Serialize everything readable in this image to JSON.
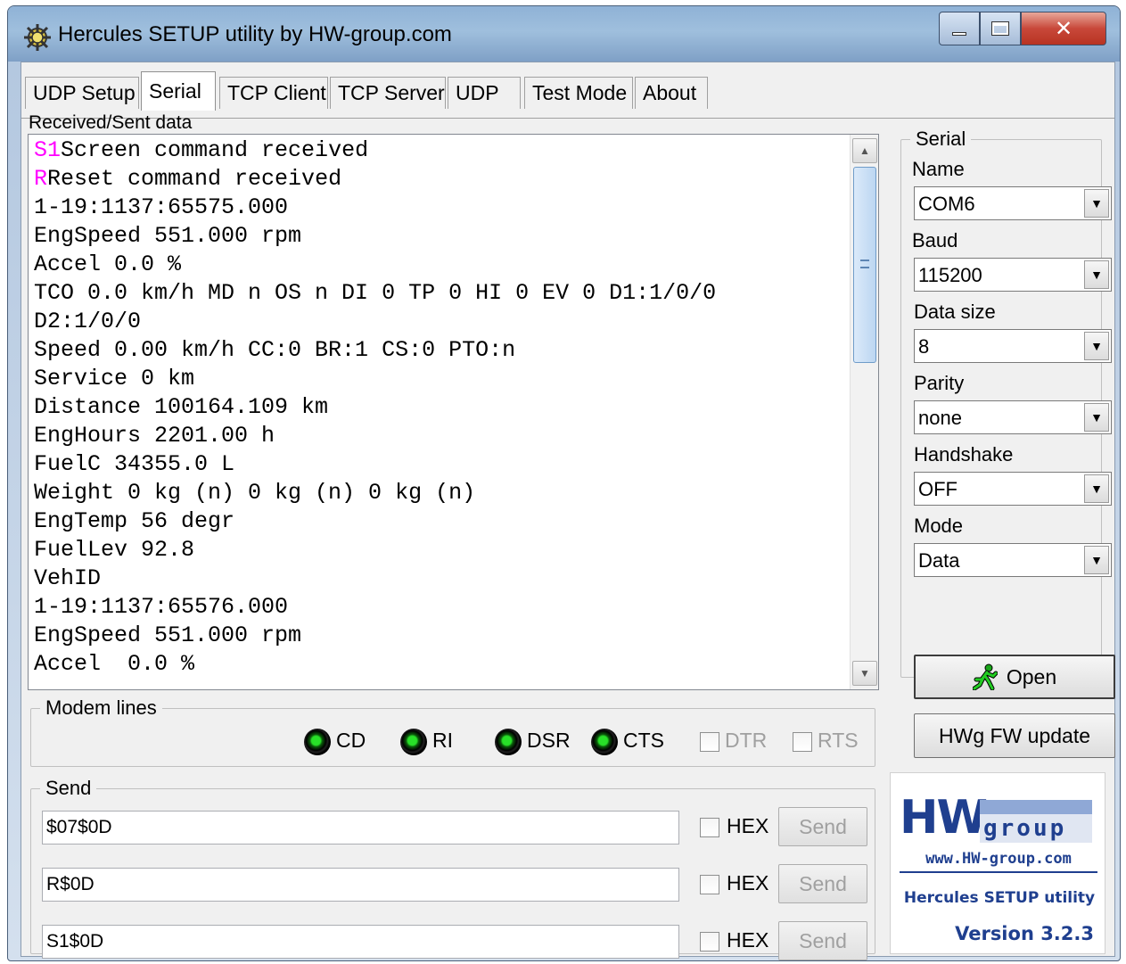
{
  "window": {
    "title": "Hercules SETUP utility by HW-group.com"
  },
  "tabs": [
    {
      "label": "UDP Setup"
    },
    {
      "label": "Serial"
    },
    {
      "label": "TCP Client"
    },
    {
      "label": "TCP Server"
    },
    {
      "label": "UDP"
    },
    {
      "label": "Test Mode"
    },
    {
      "label": "About"
    }
  ],
  "received": {
    "label": "Received/Sent data",
    "lines": [
      {
        "prefix": "S1",
        "text": "Screen command received"
      },
      {
        "prefix": "R",
        "text": "Reset command received"
      },
      {
        "prefix": "",
        "text": "1-19:1137:65575.000"
      },
      {
        "prefix": "",
        "text": "EngSpeed 551.000 rpm"
      },
      {
        "prefix": "",
        "text": "Accel 0.0 %"
      },
      {
        "prefix": "",
        "text": "TCO 0.0 km/h MD n OS n DI 0 TP 0 HI 0 EV 0 D1:1/0/0"
      },
      {
        "prefix": "",
        "text": "D2:1/0/0"
      },
      {
        "prefix": "",
        "text": "Speed 0.00 km/h CC:0 BR:1 CS:0 PTO:n"
      },
      {
        "prefix": "",
        "text": "Service 0 km"
      },
      {
        "prefix": "",
        "text": "Distance 100164.109 km"
      },
      {
        "prefix": "",
        "text": "EngHours 2201.00 h"
      },
      {
        "prefix": "",
        "text": "FuelC 34355.0 L"
      },
      {
        "prefix": "",
        "text": "Weight 0 kg (n) 0 kg (n) 0 kg (n)"
      },
      {
        "prefix": "",
        "text": "EngTemp 56 degr"
      },
      {
        "prefix": "",
        "text": "FuelLev 92.8"
      },
      {
        "prefix": "",
        "text": "VehID"
      },
      {
        "prefix": "",
        "text": "1-19:1137:65576.000"
      },
      {
        "prefix": "",
        "text": "EngSpeed 551.000 rpm"
      },
      {
        "prefix": "",
        "text": "Accel  0.0 %"
      }
    ]
  },
  "modem": {
    "title": "Modem lines",
    "leds": [
      {
        "label": "CD"
      },
      {
        "label": "RI"
      },
      {
        "label": "DSR"
      },
      {
        "label": "CTS"
      }
    ],
    "checks": [
      {
        "label": "DTR"
      },
      {
        "label": "RTS"
      }
    ]
  },
  "send": {
    "title": "Send",
    "rows": [
      {
        "value": "$07$0D",
        "hex_label": "HEX",
        "button": "Send"
      },
      {
        "value": "R$0D",
        "hex_label": "HEX",
        "button": "Send"
      },
      {
        "value": "S1$0D",
        "hex_label": "HEX",
        "button": "Send"
      }
    ]
  },
  "serial": {
    "title": "Serial",
    "name_label": "Name",
    "name": "COM6",
    "baud_label": "Baud",
    "baud": "115200",
    "datasize_label": "Data size",
    "datasize": "8",
    "parity_label": "Parity",
    "parity": "none",
    "handshake_label": "Handshake",
    "handshake": "OFF",
    "mode_label": "Mode",
    "mode": "Data",
    "open_button": "Open",
    "fw_button": "HWg FW update"
  },
  "logo": {
    "hw": "HW",
    "group": "group",
    "url": "www.HW-group.com",
    "product": "Hercules SETUP utility",
    "version": "Version  3.2.3"
  },
  "colors": {
    "echo_prefix": "#ff00ff",
    "led_on": "#28e028",
    "logo_blue": "#1f3f8f"
  }
}
